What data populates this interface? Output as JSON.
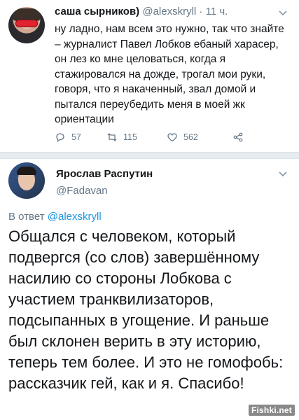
{
  "tweet1": {
    "author_name": "саша сырников)",
    "author_handle": "@alexskryll",
    "time_ago": "11 ч.",
    "body": "ну ладно, нам всем это нужно, так что знайте – журналист Павел Лобков ебаный харасер, он лез ко мне целоваться, когда я стажировался на дожде, трогал мои руки, говоря, что я накаченный, звал домой и пытался переубедить меня в моей жк ориентации",
    "reply_count": "57",
    "retweet_count": "115",
    "like_count": "562",
    "icons": [
      "reply-icon",
      "retweet-icon",
      "like-icon",
      "share-icon",
      "chevron-down-icon"
    ]
  },
  "tweet2": {
    "author_name": "Ярослав Распутин",
    "author_handle": "@Fadavan",
    "reply_prefix": "В ответ",
    "reply_to": "@alexskryll",
    "body": "Общался с человеком, который подвергся (со слов) завершённому насилию со стороны Лобкова с участием транквилизаторов, подсыпанных в угощение. И раньше был склонен верить в эту историю, теперь тем более.  И это не гомофобь: рассказчик гей, как и я. Спасибо!"
  },
  "watermark": "Fishki.net",
  "colors": {
    "text": "#14171a",
    "muted": "#657786",
    "link": "#1b95e0",
    "divider": "#e6ecf0"
  }
}
